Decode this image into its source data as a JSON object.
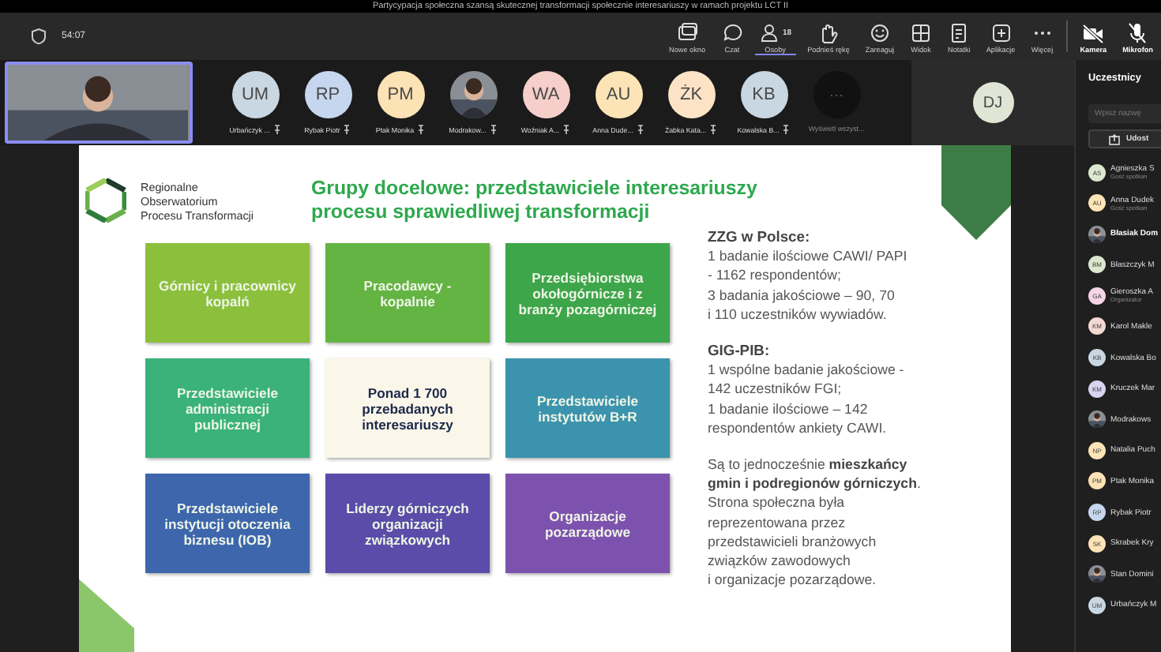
{
  "window": {
    "title": "Partycypacja społeczna szansą skutecznej transformacji społecznie interesariuszy w ramach projektu LCT II"
  },
  "toolbar": {
    "timer": "54:07",
    "actions": [
      {
        "kind": "window",
        "label": "Nowe okno",
        "selected": false
      },
      {
        "kind": "chat",
        "label": "Czat",
        "selected": false
      },
      {
        "kind": "people",
        "label": "Osoby",
        "count": "18",
        "selected": true
      },
      {
        "kind": "hand",
        "label": "Podnieś rękę",
        "selected": false
      },
      {
        "kind": "react",
        "label": "Zareaguj",
        "selected": false
      },
      {
        "kind": "view",
        "label": "Widok",
        "selected": false
      },
      {
        "kind": "notes",
        "label": "Notatki",
        "selected": false
      },
      {
        "kind": "apps",
        "label": "Aplikacje",
        "selected": false
      },
      {
        "kind": "more",
        "label": "Więcej",
        "selected": false
      },
      {
        "kind": "camera",
        "label": "Kamera",
        "selected": false
      },
      {
        "kind": "mic",
        "label": "Mikrofon",
        "selected": false
      }
    ]
  },
  "participants_strip": {
    "items": [
      {
        "kind": "initials",
        "initials": "UM",
        "name": "Urbańczyk ...",
        "color": "#c9d7e2"
      },
      {
        "kind": "initials",
        "initials": "RP",
        "name": "Rybak Piotr",
        "color": "#c6d6ef"
      },
      {
        "kind": "initials",
        "initials": "PM",
        "name": "Ptak Monika",
        "color": "#fce2b4"
      },
      {
        "kind": "picture",
        "name": "Modrakow..."
      },
      {
        "kind": "initials",
        "initials": "WA",
        "name": "Woźniak A...",
        "color": "#f6cfca"
      },
      {
        "kind": "initials",
        "initials": "AU",
        "name": "Anna Dude...",
        "color": "#fde4b6"
      },
      {
        "kind": "initials",
        "initials": "ŻK",
        "name": "Żabka Kata...",
        "color": "#fde3c6"
      },
      {
        "kind": "initials",
        "initials": "KB",
        "name": "Kowalska B...",
        "color": "#c9d7e2"
      },
      {
        "kind": "more",
        "initials": "···",
        "name": "Wyświetl wszyst..."
      }
    ],
    "featured": {
      "initials": "DJ",
      "color": "#dfe6d6"
    }
  },
  "slide": {
    "logo_text": [
      "Regionalne",
      "Obserwatorium",
      "Procesu Transformacji"
    ],
    "title": [
      "Grupy docelowe: przedstawiciele interesariuszy",
      "procesu sprawiedliwej transformacji"
    ],
    "tiles": [
      {
        "text": "Górnicy i pracownicy kopalń",
        "color": "#8cc03c",
        "emphasis": false
      },
      {
        "text": "Pracodawcy - kopalnie",
        "color": "#64b443",
        "emphasis": false
      },
      {
        "text": "Przedsiębiorstwa okołogórnicze i z branży pozagórniczej",
        "color": "#3da54a",
        "emphasis": false
      },
      {
        "text": "Przedstawiciele administracji publicznej",
        "color": "#3ab27a",
        "emphasis": false
      },
      {
        "text": "Ponad 1 700 przebadanych interesariuszy",
        "color": "#fbf6ea",
        "emphasis": true
      },
      {
        "text": "Przedstawiciele instytutów B+R",
        "color": "#3c93ad",
        "emphasis": false
      },
      {
        "text": "Przedstawiciele instytucji otoczenia biznesu (IOB)",
        "color": "#3d66ad",
        "emphasis": false
      },
      {
        "text": "Liderzy górniczych organizacji związkowych",
        "color": "#5a4ca8",
        "emphasis": false
      },
      {
        "text": "Organizacje pozarządowe",
        "color": "#7d52ae",
        "emphasis": false
      }
    ],
    "notes": [
      {
        "heading": "ZZG w Polsce:",
        "lines": [
          "1 badanie ilościowe CAWI/ PAPI",
          "- 1162 respondentów;",
          "3 badania jakościowe – 90, 70",
          "i 110 uczestników wywiadów."
        ]
      },
      {
        "heading": "GIG-PIB:",
        "lines": [
          "1 wspólne badanie jakościowe -",
          "142 uczestników FGI;",
          "1 badanie ilościowe – 142",
          "respondentów ankiety CAWI."
        ]
      },
      {
        "lines": [
          "Są to jednocześnie **mieszkańcy**",
          "**gmin i podregionów górniczych**.",
          "Strona społeczna była",
          "reprezentowana przez",
          "przedstawicieli branżowych",
          "związków zawodowych",
          "i organizacje pozarządowe."
        ]
      }
    ]
  },
  "side_panel": {
    "title": "Uczestnicy",
    "search": {
      "placeholder": "Wpisz nazwę"
    },
    "share_button": "Udost",
    "people": [
      {
        "kind": "initials",
        "initials": "AS",
        "name": "Agnieszka S",
        "role": "Gość spotkan",
        "color": "#dbe8cf",
        "highlighted": false
      },
      {
        "kind": "initials",
        "initials": "AU",
        "name": "Anna Dudek",
        "role": "Gość spotkan",
        "color": "#fde4b6",
        "highlighted": false
      },
      {
        "kind": "picture",
        "name": "Błasiak Dom",
        "highlighted": true
      },
      {
        "kind": "initials",
        "initials": "BM",
        "name": "Błaszczyk M",
        "color": "#dbe8cf",
        "highlighted": false
      },
      {
        "kind": "initials",
        "initials": "GA",
        "name": "Gieroszka A",
        "role": "Organizator",
        "color": "#f4d4e6",
        "highlighted": false
      },
      {
        "kind": "initials",
        "initials": "KM",
        "name": "Karol Makle",
        "color": "#f3d9d2",
        "highlighted": false
      },
      {
        "kind": "initials",
        "initials": "KB",
        "name": "Kowalska Bo",
        "color": "#c9d7e2",
        "highlighted": false
      },
      {
        "kind": "initials",
        "initials": "KM",
        "name": "Kruczek Mar",
        "color": "#d9d4f1",
        "highlighted": false
      },
      {
        "kind": "picture",
        "name": "Modrakows",
        "highlighted": false
      },
      {
        "kind": "initials",
        "initials": "NP",
        "name": "Natalia Puch",
        "color": "#fde4b6",
        "highlighted": false
      },
      {
        "kind": "initials",
        "initials": "PM",
        "name": "Ptak Monika",
        "color": "#fce2b4",
        "highlighted": false
      },
      {
        "kind": "initials",
        "initials": "RP",
        "name": "Rybak Piotr",
        "color": "#c6d6ef",
        "highlighted": false
      },
      {
        "kind": "initials",
        "initials": "SK",
        "name": "Skrabek Kry",
        "color": "#fde4b6",
        "highlighted": false
      },
      {
        "kind": "picture",
        "name": "Stan Domini",
        "highlighted": false
      },
      {
        "kind": "initials",
        "initials": "UM",
        "name": "Urbańczyk M",
        "color": "#c9d7e2",
        "highlighted": false
      }
    ]
  }
}
